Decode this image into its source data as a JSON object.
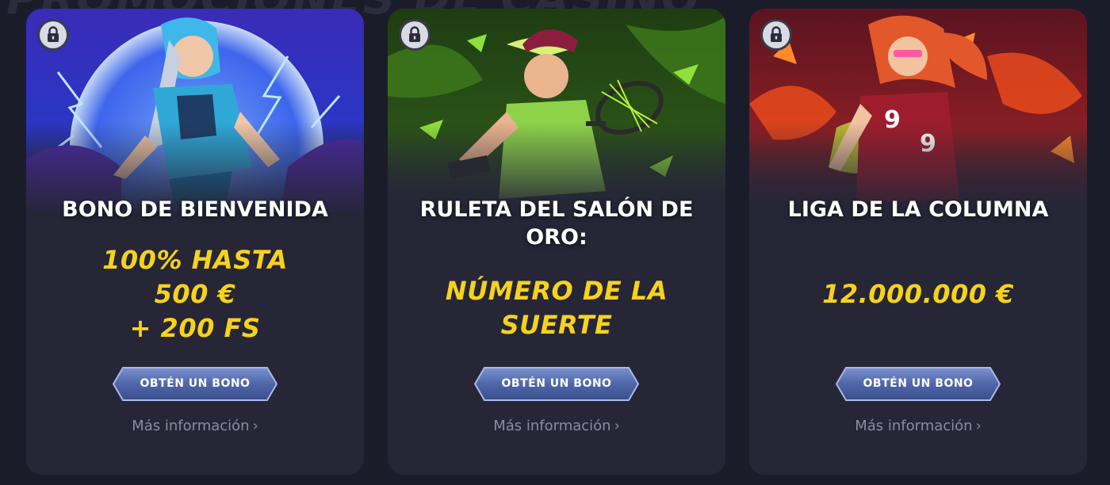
{
  "background_heading": "PROMOCIONES DE CASINO",
  "colors": {
    "page_bg": "#1b1c2a",
    "card_bg": "#262637",
    "title": "#ffffff",
    "value": "#f7d21c",
    "button": "#4f66a8",
    "link": "#8a8ba0"
  },
  "cards": [
    {
      "title": "BONO DE BIENVENIDA",
      "value_lines": [
        "100% HASTA",
        "500 €",
        "+ 200 FS"
      ],
      "button_label": "OBTÉN UN BONO",
      "link_label": "Más información",
      "link_icon": "chevron-right-icon",
      "badge_icon": "lock-icon",
      "art_theme": "blue-storm"
    },
    {
      "title_lines": [
        "RULETA DEL SALÓN DE",
        "ORO:"
      ],
      "value_lines": [
        "NÚMERO DE LA",
        "SUERTE"
      ],
      "button_label": "OBTÉN UN BONO",
      "link_label": "Más información",
      "link_icon": "chevron-right-icon",
      "badge_icon": "lock-icon",
      "art_theme": "green-tennis"
    },
    {
      "title": "LIGA DE LA COLUMNA",
      "value_lines": [
        "12.000.000 €"
      ],
      "button_label": "OBTÉN UN BONO",
      "link_label": "Más información",
      "link_icon": "chevron-right-icon",
      "badge_icon": "lock-icon",
      "art_theme": "red-fire"
    }
  ]
}
